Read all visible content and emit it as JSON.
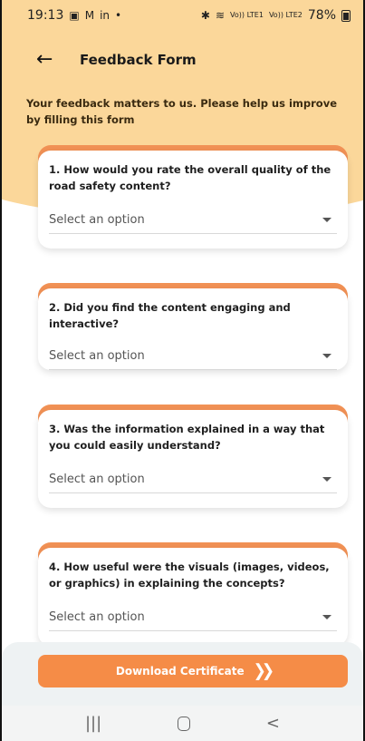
{
  "status_bar": {
    "time": "19:13",
    "left_icons": [
      "gallery-icon",
      "gmail-icon",
      "linkedin-icon",
      "dot-icon"
    ],
    "network_1": "Vo)) LTE1",
    "network_2": "Vo)) LTE2",
    "battery": "78%"
  },
  "appbar": {
    "title": "Feedback Form"
  },
  "intro": "Your feedback matters to us. Please help us improve by filling this form",
  "questions": [
    {
      "text": "1. How would you rate the overall quality of the road safety content?",
      "placeholder": "Select an option"
    },
    {
      "text": "2. Did you find the content engaging and interactive?",
      "placeholder": "Select an option"
    },
    {
      "text": "3. Was the information explained in a way that you could easily understand?",
      "placeholder": "Select an option"
    },
    {
      "text": "4. How useful were the visuals (images, videos, or graphics) in explaining the concepts?",
      "placeholder": "Select an option"
    }
  ],
  "download": {
    "label": "Download Certificate",
    "icon": "double-chevron-right-icon"
  },
  "colors": {
    "hero": "#fbd79a",
    "accent": "#f19155",
    "button": "#f58c47"
  }
}
